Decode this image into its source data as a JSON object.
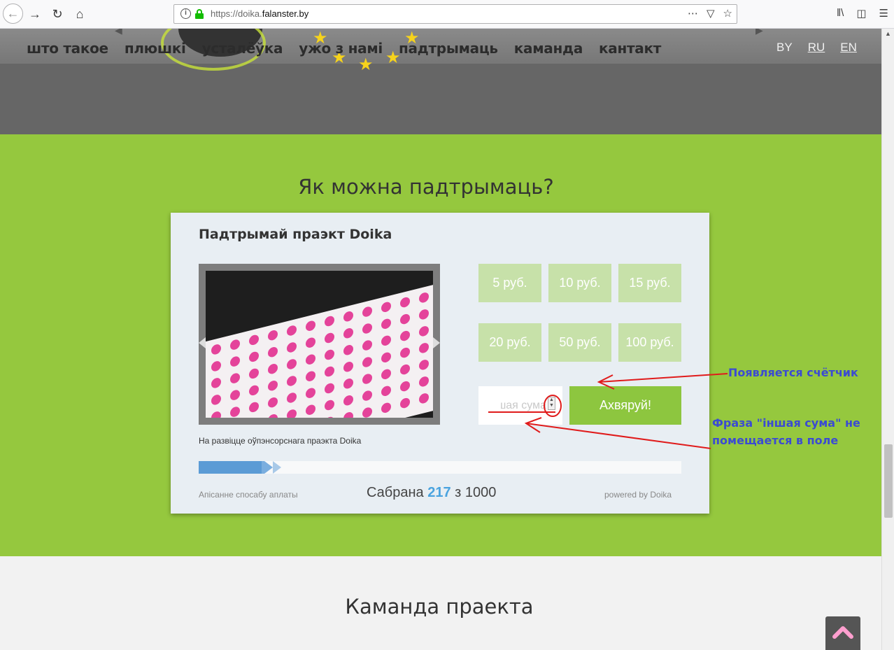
{
  "browser": {
    "url_prefix": "https://doika.",
    "url_domain": "falanster.by",
    "back_icon": "arrow-left-icon",
    "forward_icon": "arrow-right-icon"
  },
  "nav": {
    "items": [
      "што такое",
      "плюшкі",
      "усталёўка",
      "ужо з намі",
      "падтрымаць",
      "каманда",
      "кантакт"
    ],
    "lang": [
      "BY",
      "RU",
      "EN"
    ]
  },
  "section": {
    "title": "Як можна падтрымаць?"
  },
  "widget": {
    "title": "Падтрымай праэкт Doika",
    "caption": "На развіцце оўпэнсорснага праэкта Doika",
    "amounts": [
      "5 руб.",
      "10 руб.",
      "15 руб.",
      "20 руб.",
      "50 руб.",
      "100 руб."
    ],
    "other_sum_placeholder": "іншая сума",
    "donate_label": "Ахвяруй!",
    "payment_desc": "Апісанне спосабу аплаты",
    "collected_prefix": "Сабрана",
    "collected_value": "217",
    "collected_suffix": "з 1000",
    "powered": "powered by Doika",
    "progress_fraction": 0.217
  },
  "annotations": {
    "counter_note": "Появляется счётчик",
    "phrase_note_1": "Фраза \"іншая сума\" не",
    "phrase_note_2": "помещается в поле"
  },
  "team": {
    "title": "Каманда праекта"
  },
  "colors": {
    "green": "#95c83e",
    "header_gray": "#666666",
    "annotation": "#3b4bd2",
    "arrow_red": "#e01b1b",
    "accent_blue": "#4aa3df"
  }
}
